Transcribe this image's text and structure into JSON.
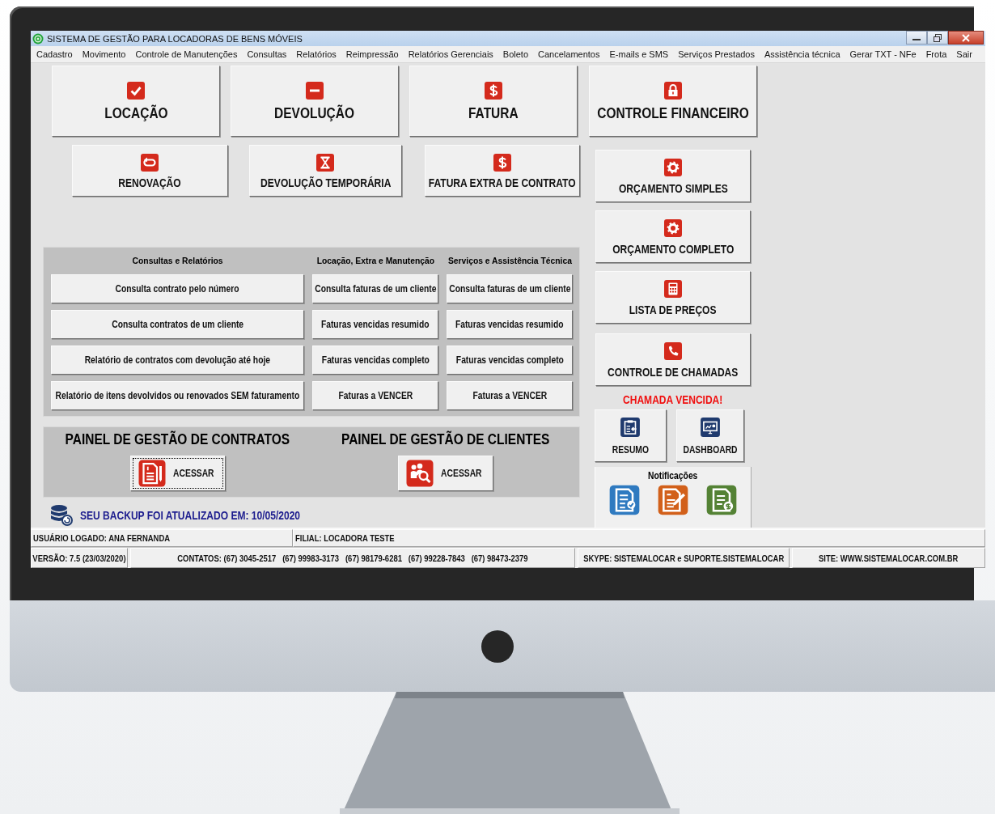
{
  "window": {
    "title": "SISTEMA DE GESTÃO PARA LOCADORAS DE BENS MÓVEIS"
  },
  "menu": [
    "Cadastro",
    "Movimento",
    "Controle de Manutenções",
    "Consultas",
    "Relatórios",
    "Reimpressão",
    "Relatórios Gerenciais",
    "Boleto",
    "Cancelamentos",
    "E-mails e SMS",
    "Serviços Prestados",
    "Assistência técnica",
    "Gerar TXT - NFe",
    "Frota",
    "Sair"
  ],
  "main_buttons": [
    {
      "label": "LOCAÇÃO",
      "kind": "check"
    },
    {
      "label": "DEVOLUÇÃO",
      "kind": "minus"
    },
    {
      "label": "FATURA",
      "kind": "dollar"
    }
  ],
  "secondary_buttons": [
    {
      "label": "RENOVAÇÃO",
      "kind": "renew"
    },
    {
      "label": "DEVOLUÇÃO TEMPORÁRIA",
      "kind": "hourglass"
    },
    {
      "label": "FATURA EXTRA DE CONTRATO",
      "kind": "dollar"
    }
  ],
  "reports_panel": {
    "columns": [
      {
        "heading": "Consultas e Relatórios",
        "buttons": [
          "Consulta contrato pelo número",
          "Consulta contratos de um cliente",
          "Relatório de contratos com devolução até hoje",
          "Relatório de itens devolvidos ou renovados SEM faturamento"
        ]
      },
      {
        "heading": "Locação, Extra e Manutenção",
        "buttons": [
          "Consulta faturas de um cliente",
          "Faturas vencidas resumido",
          "Faturas vencidas completo",
          "Faturas a VENCER"
        ]
      },
      {
        "heading": "Serviços e Assistência Técnica",
        "buttons": [
          "Consulta faturas de um cliente",
          "Faturas vencidas resumido",
          "Faturas vencidas completo",
          "Faturas a VENCER"
        ]
      }
    ]
  },
  "management_panels": [
    {
      "title": "PAINEL DE GESTÃO DE CONTRATOS",
      "button": "ACESSAR",
      "kind": "contract",
      "focused": true
    },
    {
      "title": "PAINEL DE GESTÃO DE CLIENTES",
      "button": "ACESSAR",
      "kind": "clients",
      "focused": false
    }
  ],
  "backup_message": "SEU BACKUP FOI ATUALIZADO EM: 10/05/2020",
  "side_buttons": [
    {
      "label": "CONTROLE FINANCEIRO",
      "kind": "lock"
    },
    {
      "label": "ORÇAMENTO SIMPLES",
      "kind": "gear"
    },
    {
      "label": "ORÇAMENTO COMPLETO",
      "kind": "gear"
    },
    {
      "label": "LISTA DE PREÇOS",
      "kind": "calculator"
    },
    {
      "label": "CONTROLE DE CHAMADAS",
      "kind": "phone"
    }
  ],
  "alert": "CHAMADA VENCIDA!",
  "shortcuts": [
    {
      "label": "RESUMO",
      "kind": "clipboard"
    },
    {
      "label": "DASHBOARD",
      "kind": "monitor"
    }
  ],
  "notifications": {
    "title": "Notificações",
    "items": [
      {
        "kind": "checklist",
        "color": "#2f7ac0"
      },
      {
        "kind": "docpen",
        "color": "#d2601a"
      },
      {
        "kind": "docdollar",
        "color": "#548235"
      }
    ]
  },
  "status_bar": {
    "user": "USUÁRIO LOGADO: ANA FERNANDA",
    "branch": "FILIAL: LOCADORA TESTE",
    "version": "VERSÃO: 7.5 (23/03/2020)",
    "contacts": "CONTATOS: (67) 3045-2517   (67) 99983-3173   (67) 98179-6281   (67) 99228-7843   (67) 98473-2379",
    "skype": "SKYPE: SISTEMALOCAR e SUPORTE.SISTEMALOCAR",
    "site": "SITE: WWW.SISTEMALOCAR.COM.BR"
  }
}
